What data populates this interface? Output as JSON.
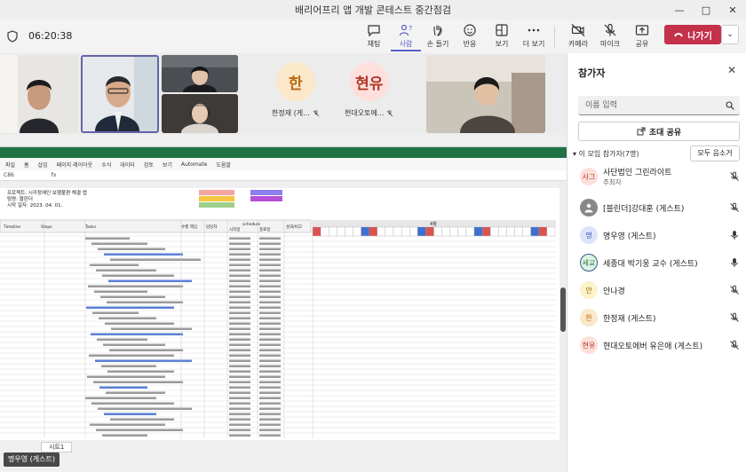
{
  "window": {
    "title": "배리어프리 앱 개발 콘테스트 중간점검"
  },
  "toolbar": {
    "timer": "06:20:38",
    "buttons": [
      {
        "label": "채팅",
        "icon": "chat-icon"
      },
      {
        "label": "사람",
        "icon": "people-icon",
        "badge": "7",
        "active": true
      },
      {
        "label": "손 들기",
        "icon": "raise-hand-icon"
      },
      {
        "label": "반응",
        "icon": "reaction-icon"
      },
      {
        "label": "보기",
        "icon": "view-icon"
      },
      {
        "label": "더 보기",
        "icon": "more-icon"
      },
      {
        "label": "카메라",
        "icon": "camera-off-icon"
      },
      {
        "label": "마이크",
        "icon": "mic-off-icon"
      },
      {
        "label": "공유",
        "icon": "share-icon"
      }
    ],
    "leave_label": "나가기"
  },
  "videos": {
    "avatars": [
      {
        "initial": "한",
        "name": "한정재 (게...",
        "bg": "#fbe7c9",
        "fg": "#b86a10"
      },
      {
        "initial": "현유",
        "name": "현대오토에...",
        "bg": "#fde0dc",
        "fg": "#b2382a"
      }
    ]
  },
  "shared_screen": {
    "ribbon": [
      "파일",
      "홈",
      "삽입",
      "페이지 레이아웃",
      "수식",
      "데이터",
      "검토",
      "보기",
      "Automate",
      "도움말"
    ],
    "cell_ref": "C86",
    "sheet_tab": "시트1",
    "header_rows": [
      "프로젝트: 시각장애인 보행불편 해결 앱",
      "팀명: 블린더",
      "시작 일자: 2023. 04. 01."
    ],
    "schedule_label": "schedule",
    "month_label": "4월",
    "columns": [
      "Timeline",
      "Steps",
      "Tasks",
      "수행 책임",
      "담당자",
      "시작일",
      "종료일",
      "성과/비고"
    ]
  },
  "presenter_tag": "명우영 (게스트)",
  "panel": {
    "title": "참가자",
    "search_placeholder": "이름 입력",
    "invite_label": "초대 공유",
    "section_title": "이 모임 참가자(7명)",
    "mute_all_label": "모두 음소거",
    "participants": [
      {
        "initial": "사그",
        "name": "사단법인 그린라이트",
        "role": "주최자",
        "bg": "#fde0dc",
        "fg": "#b2382a",
        "mic": "muted"
      },
      {
        "initial": "",
        "name": "[블린더]강대훈 (게스트)",
        "role": "",
        "bg": "#8a8886",
        "fg": "#ffffff",
        "mic": "muted"
      },
      {
        "initial": "명",
        "name": "명우영 (게스트)",
        "role": "",
        "bg": "#dce4fa",
        "fg": "#3b5bb5",
        "mic": "on"
      },
      {
        "initial": "세교",
        "name": "세종대 박기웅 교수 (게스트)",
        "role": "",
        "bg": "#dff3e4",
        "fg": "#2f7a44",
        "mic": "on",
        "ring": true
      },
      {
        "initial": "안",
        "name": "안나경",
        "role": "",
        "bg": "#fdf3c9",
        "fg": "#8a6a00",
        "mic": "muted"
      },
      {
        "initial": "한",
        "name": "한정재 (게스트)",
        "role": "",
        "bg": "#fbe7c9",
        "fg": "#b86a10",
        "mic": "muted"
      },
      {
        "initial": "현유",
        "name": "현대오토에버 유은애 (게스트)",
        "role": "",
        "bg": "#fde0dc",
        "fg": "#b2382a",
        "mic": "muted"
      }
    ]
  }
}
